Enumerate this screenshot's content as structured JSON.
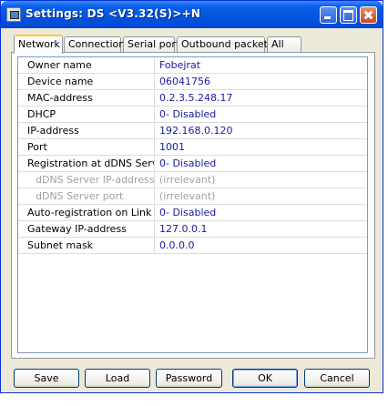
{
  "window": {
    "title": "Settings: DS <V3.32(S)>+N"
  },
  "tabs": [
    {
      "label": "Network",
      "active": true
    },
    {
      "label": "Connection",
      "active": false
    },
    {
      "label": "Serial port",
      "active": false
    },
    {
      "label": "Outbound packets",
      "active": false
    },
    {
      "label": "All",
      "active": false
    }
  ],
  "settings": [
    {
      "name": "Owner name",
      "value": "Fobejrat",
      "sub": false
    },
    {
      "name": "Device name",
      "value": "06041756",
      "sub": false
    },
    {
      "name": "MAC-address",
      "value": "0.2.3.5.248.17",
      "sub": false
    },
    {
      "name": "DHCP",
      "value": "0- Disabled",
      "sub": false
    },
    {
      "name": "IP-address",
      "value": "192.168.0.120",
      "sub": false
    },
    {
      "name": "Port",
      "value": "1001",
      "sub": false
    },
    {
      "name": "Registration at dDNS Server",
      "value": "0- Disabled",
      "sub": false
    },
    {
      "name": "dDNS Server IP-address",
      "value": "(irrelevant)",
      "sub": true
    },
    {
      "name": "dDNS Server port",
      "value": "(irrelevant)",
      "sub": true
    },
    {
      "name": "Auto-registration on Link Server",
      "value": "0- Disabled",
      "sub": false
    },
    {
      "name": "Gateway IP-address",
      "value": "127.0.0.1",
      "sub": false
    },
    {
      "name": "Subnet mask",
      "value": "0.0.0.0",
      "sub": false
    }
  ],
  "buttons": {
    "save": "Save",
    "load": "Load",
    "password": "Password",
    "ok": "OK",
    "cancel": "Cancel"
  },
  "colors": {
    "titlebar": "#0454e0",
    "value_text": "#1a1aa6",
    "disabled_text": "#a0a0a0"
  }
}
